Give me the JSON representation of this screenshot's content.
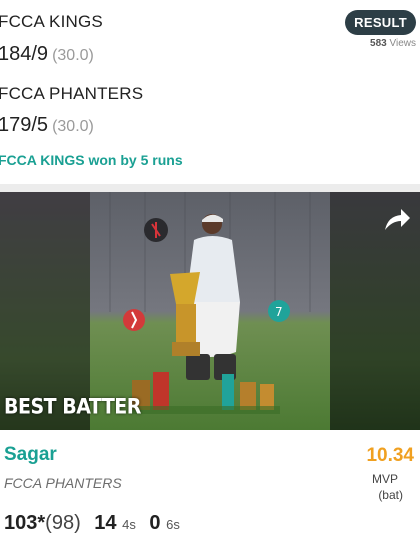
{
  "match": {
    "team1_name": "FCCA KINGS",
    "team1_score": "184/9",
    "team1_overs": "(30.0)",
    "team2_name": "FCCA PHANTERS",
    "team2_score": "179/5",
    "team2_overs": "(30.0)",
    "result_badge": "RESULT",
    "views_count": "583",
    "views_label": "Views",
    "result_text": "FCCA KINGS won by 5 runs"
  },
  "highlight": {
    "caption": "BEST BATTER",
    "share_icon": "share-icon",
    "player_name": "Sagar",
    "player_team": "FCCA PHANTERS",
    "mvp_score": "10.34",
    "mvp_label": "MVP",
    "mvp_sub": "(bat)",
    "runs": "103*",
    "balls": "(98)",
    "fours": "14",
    "fours_unit": "4s",
    "sixes": "0",
    "sixes_unit": "6s"
  },
  "colors": {
    "accent_teal": "#1aa093",
    "badge_bg": "#2d3e46",
    "mvp_orange": "#f0a020"
  }
}
